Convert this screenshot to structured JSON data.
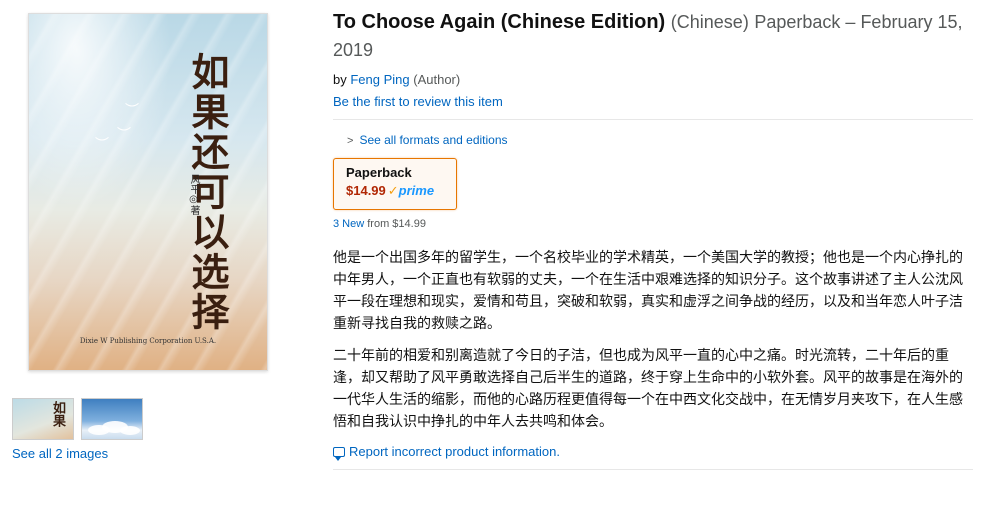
{
  "cover": {
    "title_glyphs": "如果还可以选择",
    "author_glyphs": "风平◎著",
    "publisher": "Dixie W Publishing Corporation U.S.A."
  },
  "thumbnails": {
    "see_all_label": "See all 2 images",
    "thumb1_glyphs": "如果"
  },
  "product": {
    "title": "To Choose Again (Chinese Edition)",
    "language": "(Chinese)",
    "binding_date": "Paperback – February 15, 2019",
    "by_label": "by",
    "author_name": "Feng Ping",
    "author_role": "(Author)",
    "review_link": "Be the first to review this item"
  },
  "formats": {
    "see_all_label": "See all formats and editions",
    "selected": {
      "label": "Paperback",
      "price": "$14.99",
      "prime_check": "✓",
      "prime_word": "prime"
    },
    "offers_link": "3 New",
    "offers_from": "from $14.99"
  },
  "description": {
    "para1": "他是一个出国多年的留学生，一个名校毕业的学术精英，一个美国大学的教授；他也是一个内心挣扎的中年男人，一个正直也有软弱的丈夫，一个在生活中艰难选择的知识分子。这个故事讲述了主人公沈风平一段在理想和现实，爱情和苟且，突破和软弱，真实和虚浮之间争战的经历，以及和当年恋人叶子洁重新寻找自我的救赎之路。",
    "para2": "二十年前的相爱和别离造就了今日的子洁，但也成为风平一直的心中之痛。时光流转，二十年后的重逢，却又帮助了风平勇敢选择自己后半生的道路，终于穿上生命中的小软外套。风平的故事是在海外的一代华人生活的缩影，而他的心路历程更值得每一个在中西文化交战中，在无情岁月夹攻下，在人生感悟和自我认识中挣扎的中年人去共鸣和体会。"
  },
  "report": {
    "label": "Report incorrect product information."
  }
}
